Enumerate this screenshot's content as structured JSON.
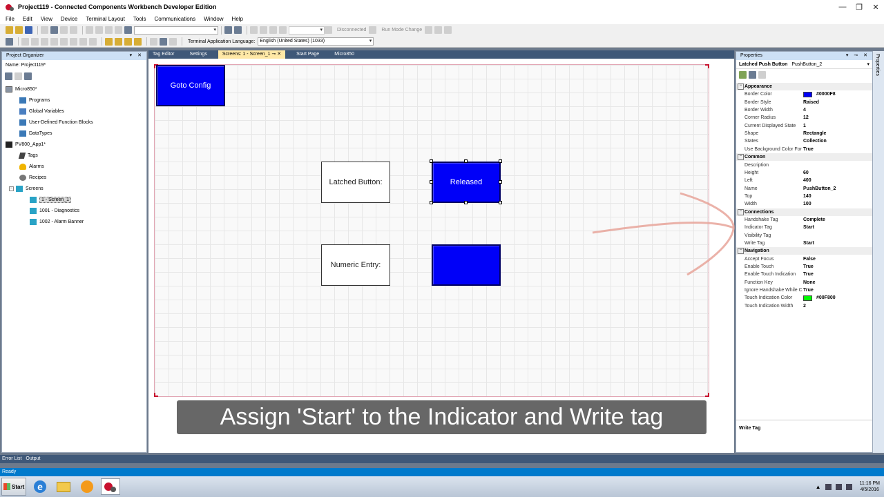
{
  "window": {
    "title": "Project119 - Connected Components Workbench Developer Edition"
  },
  "menu": [
    "File",
    "Edit",
    "View",
    "Device",
    "Terminal Layout",
    "Tools",
    "Communications",
    "Window",
    "Help"
  ],
  "toolbar": {
    "disconnected": "Disconnected",
    "run_mode_change": "Run Mode Change",
    "terminal_language_label": "Terminal Application Language:",
    "terminal_language_value": "English (United States) (1033)"
  },
  "organizer": {
    "header": "Project Organizer",
    "name_label": "Name:  Project119*",
    "tree": [
      {
        "label": "Micro850*",
        "icon": "controller-icon"
      },
      {
        "label": "Programs",
        "icon": "programs-icon"
      },
      {
        "label": "Global Variables",
        "icon": "variables-icon"
      },
      {
        "label": "User-Defined Function Blocks",
        "icon": "function-block-icon"
      },
      {
        "label": "DataTypes",
        "icon": "datatypes-icon"
      },
      {
        "label": "PV800_App1*",
        "icon": "terminal-icon"
      },
      {
        "label": "Tags",
        "icon": "tag-icon"
      },
      {
        "label": "Alarms",
        "icon": "bell-icon"
      },
      {
        "label": "Recipes",
        "icon": "gear-icon"
      },
      {
        "label": "Screens",
        "icon": "screens-icon"
      },
      {
        "label": "1 - Screen_1",
        "icon": "screen-icon"
      },
      {
        "label": "1001 - Diagnostics",
        "icon": "screen-icon"
      },
      {
        "label": "1002 - Alarm Banner",
        "icon": "screen-icon"
      }
    ]
  },
  "doc_tabs": [
    "Tag Editor",
    "Settings",
    "Screens: 1 - Screen_1",
    "Start Page",
    "Micro850"
  ],
  "screen": {
    "goto_config": "Goto Config",
    "latched_label": "Latched Button:",
    "released": "Released",
    "numeric_label": "Numeric Entry:",
    "numeric_value": ""
  },
  "caption": "Assign 'Start' to the Indicator and Write tag",
  "properties": {
    "header": "Properties",
    "selected_type": "Latched Push Button",
    "selected_name": "PushButton_2",
    "rows": [
      {
        "cat": "Appearance"
      },
      {
        "name": "Border Color",
        "value": "#0000F8",
        "swatch": "#0000F8"
      },
      {
        "name": "Border Style",
        "value": "Raised"
      },
      {
        "name": "Border Width",
        "value": "4"
      },
      {
        "name": "Corner Radius",
        "value": "12"
      },
      {
        "name": "Current Displayed State",
        "value": "1"
      },
      {
        "name": "Shape",
        "value": "Rectangle"
      },
      {
        "name": "States",
        "value": "Collection"
      },
      {
        "name": "Use Background Color For",
        "value": "True"
      },
      {
        "cat": "Common"
      },
      {
        "name": "Description",
        "value": ""
      },
      {
        "name": "Height",
        "value": "60"
      },
      {
        "name": "Left",
        "value": "400"
      },
      {
        "name": "Name",
        "value": "PushButton_2"
      },
      {
        "name": "Top",
        "value": "140"
      },
      {
        "name": "Width",
        "value": "100"
      },
      {
        "cat": "Connections"
      },
      {
        "name": "Handshake Tag",
        "value": "Complete"
      },
      {
        "name": "Indicator Tag",
        "value": "Start"
      },
      {
        "name": "Visibility Tag",
        "value": ""
      },
      {
        "name": "Write Tag",
        "value": "Start"
      },
      {
        "cat": "Navigation"
      },
      {
        "name": "Accept Focus",
        "value": "False"
      },
      {
        "name": "Enable Touch",
        "value": "True"
      },
      {
        "name": "Enable Touch Indication",
        "value": "True"
      },
      {
        "name": "Function Key",
        "value": "None"
      },
      {
        "name": "Ignore Handshake While C",
        "value": "True"
      },
      {
        "name": "Touch Indication Color",
        "value": "#00F800",
        "swatch": "#00F800"
      },
      {
        "name": "Touch Indication Width",
        "value": "2"
      }
    ],
    "description_title": "Write Tag"
  },
  "right_strip_label": "Properties",
  "bottom_tabs": [
    "Error List",
    "Output"
  ],
  "status": "Ready",
  "taskbar": {
    "start": "Start",
    "time": "11:16 PM",
    "date": "4/5/2016"
  },
  "colors": {
    "hmi_blue": "#0000f8",
    "status_blue": "#007acc",
    "tab_bar": "#3f5878"
  }
}
